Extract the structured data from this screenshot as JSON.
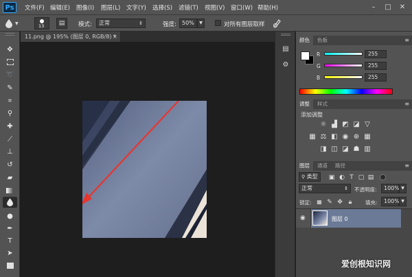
{
  "app": {
    "logo": "Ps"
  },
  "menu": [
    "文件(F)",
    "编辑(E)",
    "图像(I)",
    "图层(L)",
    "文字(Y)",
    "选择(S)",
    "滤镜(T)",
    "视图(V)",
    "窗口(W)",
    "帮助(H)"
  ],
  "window_controls": {
    "minimize": "–",
    "restore": "□",
    "close": "✕"
  },
  "options": {
    "brush_size": "13",
    "mode_label": "模式:",
    "mode_value": "正常",
    "strength_label": "强度:",
    "strength_value": "50%",
    "sample_all_layers": "对所有图层取样",
    "sample_all_layers_checked": false
  },
  "document": {
    "tab_title": "11.png @ 195% (图层 0, RGB/8) *",
    "close": "×"
  },
  "color_panel": {
    "tabs": [
      "颜色",
      "色板"
    ],
    "channels": [
      {
        "label": "R",
        "value": "255"
      },
      {
        "label": "G",
        "value": "255"
      },
      {
        "label": "B",
        "value": "255"
      }
    ],
    "foreground": "#ffffff",
    "background": "#000000"
  },
  "adjustments_panel": {
    "tabs": [
      "调整",
      "样式"
    ],
    "title": "添加调整"
  },
  "layers_panel": {
    "tabs": [
      "图层",
      "通道",
      "路径"
    ],
    "filter_label": "类型",
    "blend_mode": "正常",
    "opacity_label": "不透明度:",
    "opacity_value": "100%",
    "lock_label": "锁定:",
    "fill_label": "填充:",
    "fill_value": "100%",
    "layers": [
      {
        "name": "图层 0",
        "visible": true,
        "selected": true
      }
    ]
  },
  "watermark": "爱创根知识网",
  "colors": {
    "accent_arrow": "#e8352f",
    "selected_layer": "#6b7a96"
  }
}
